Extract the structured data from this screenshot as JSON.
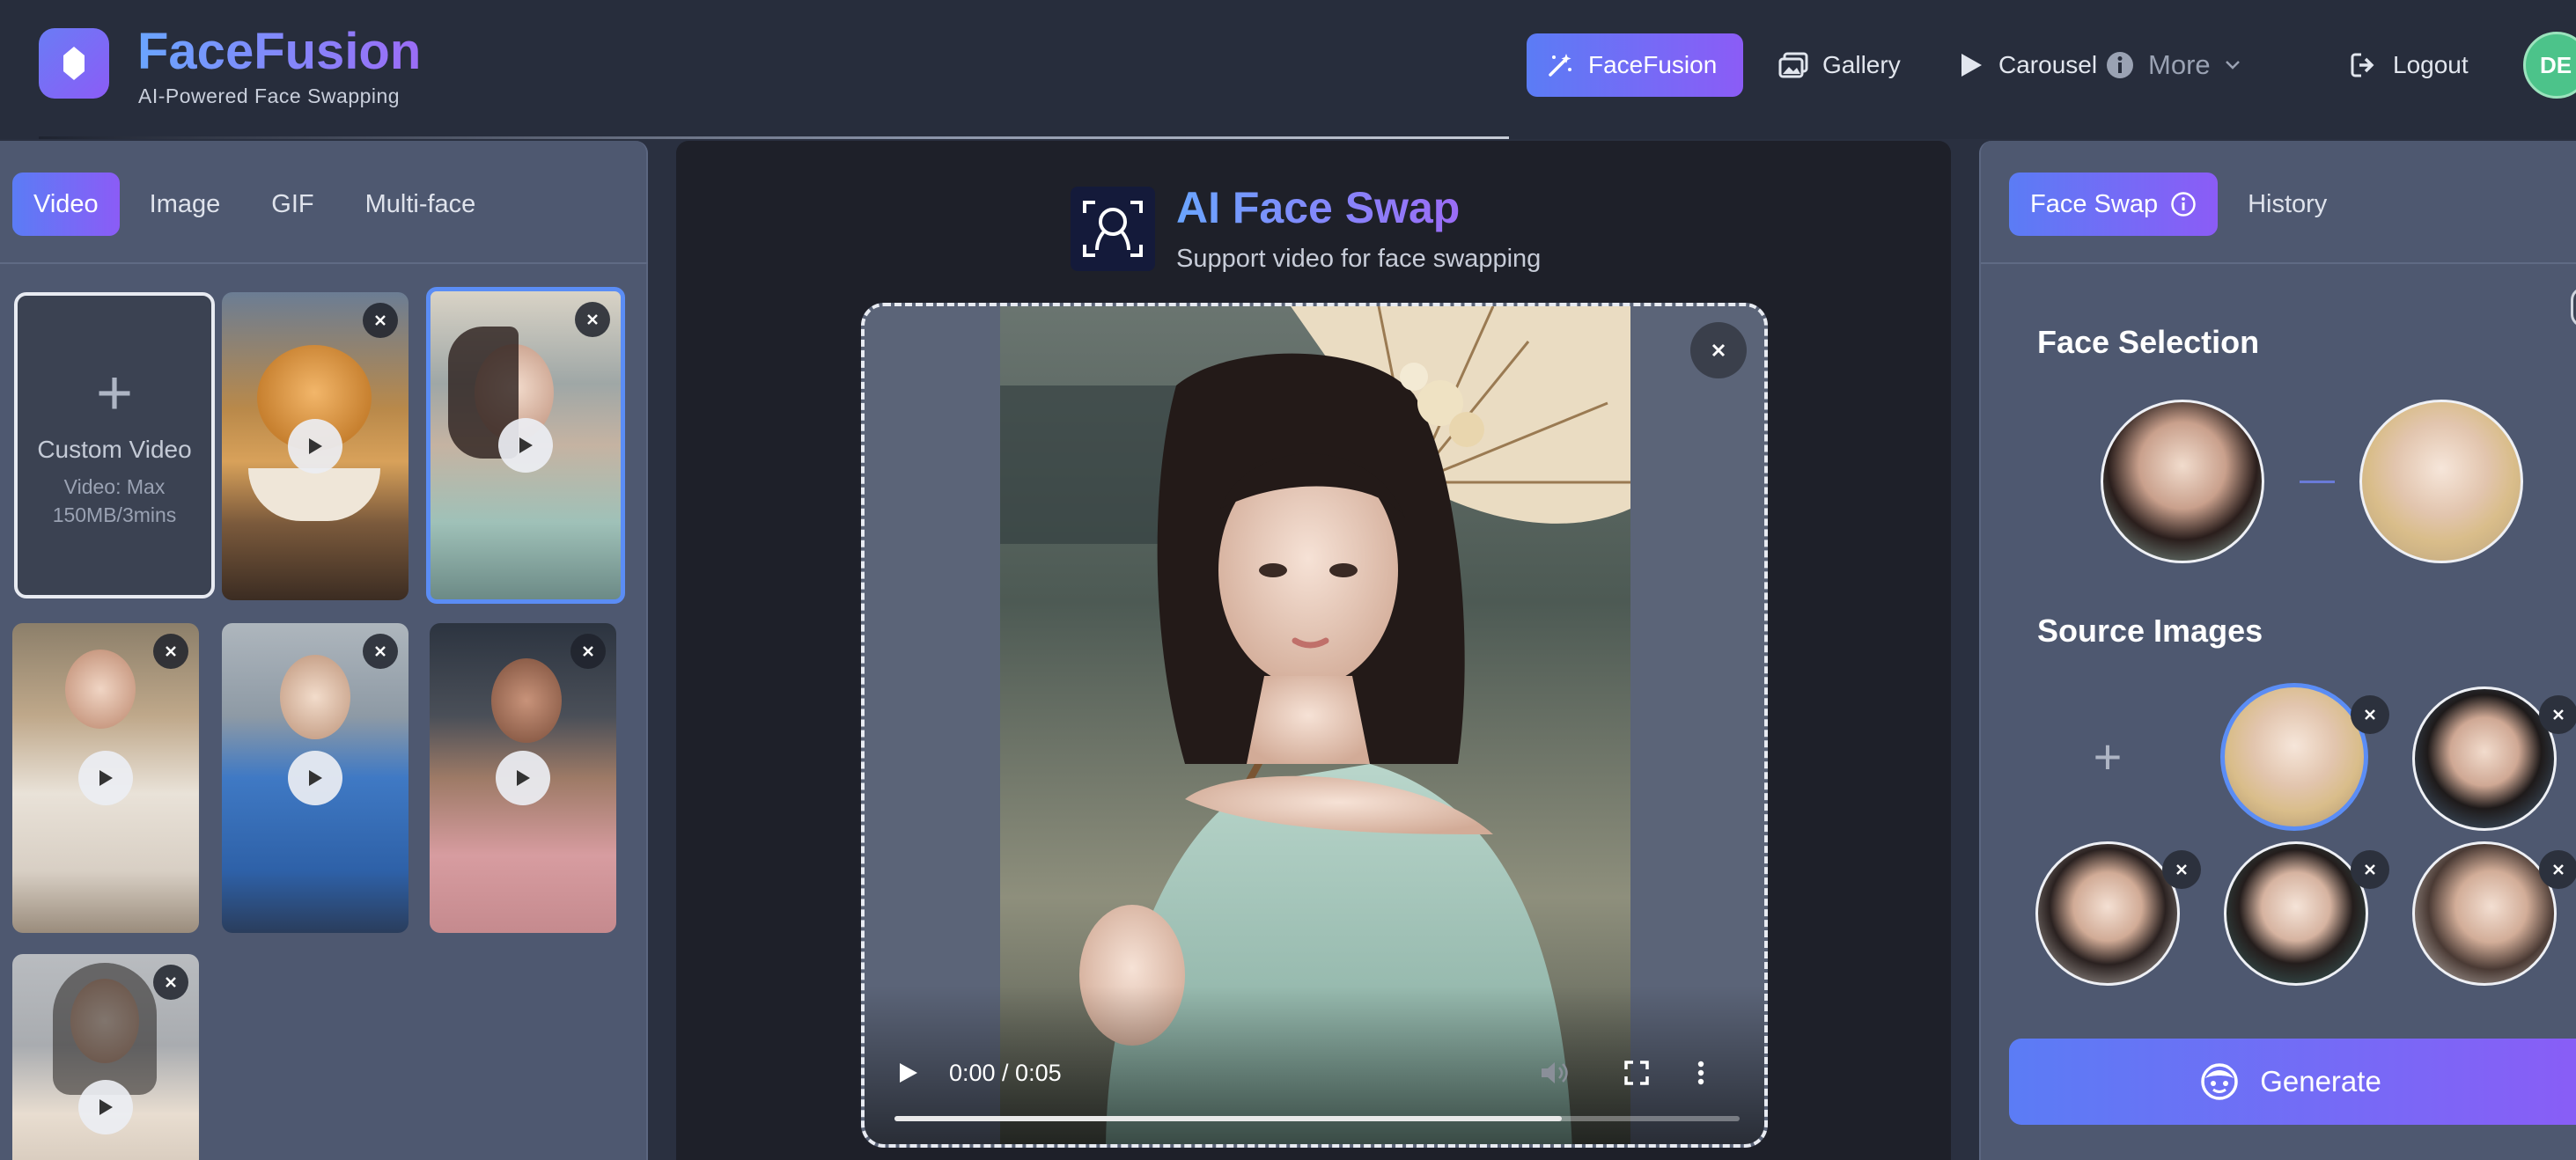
{
  "app": {
    "title": "FaceFusion",
    "subtitle": "AI-Powered Face Swapping"
  },
  "nav": {
    "items": [
      {
        "label": "FaceFusion",
        "icon": "magic-wand-icon",
        "active": true
      },
      {
        "label": "Gallery",
        "icon": "gallery-icon"
      },
      {
        "label": "Carousel",
        "icon": "play-icon"
      },
      {
        "label": "More",
        "icon": "info-icon"
      },
      {
        "label": "Logout",
        "icon": "logout-icon"
      }
    ],
    "avatar_initials": "DE"
  },
  "left": {
    "tabs": [
      "Video",
      "Image",
      "GIF",
      "Multi-face"
    ],
    "active_tab": "Video",
    "custom_video": {
      "plus": "+",
      "title": "Custom Video",
      "subtitle": "Video: Max 150MB/3mins"
    }
  },
  "center": {
    "title": "AI Face Swap",
    "subtitle": "Support video for face swapping",
    "player": {
      "time": "0:00 / 0:05",
      "progress": 0.79
    }
  },
  "right": {
    "tabs": [
      "Face Swap",
      "History"
    ],
    "active_tab": "Face Swap",
    "face_selection_title": "Face Selection",
    "source_images_title": "Source Images",
    "add_label": "+",
    "generate_label": "Generate"
  },
  "colors": {
    "accent_start": "#5b7cf5",
    "accent_end": "#8b5cf6",
    "panel": "#4e5870",
    "center_bg": "#1e2029"
  }
}
